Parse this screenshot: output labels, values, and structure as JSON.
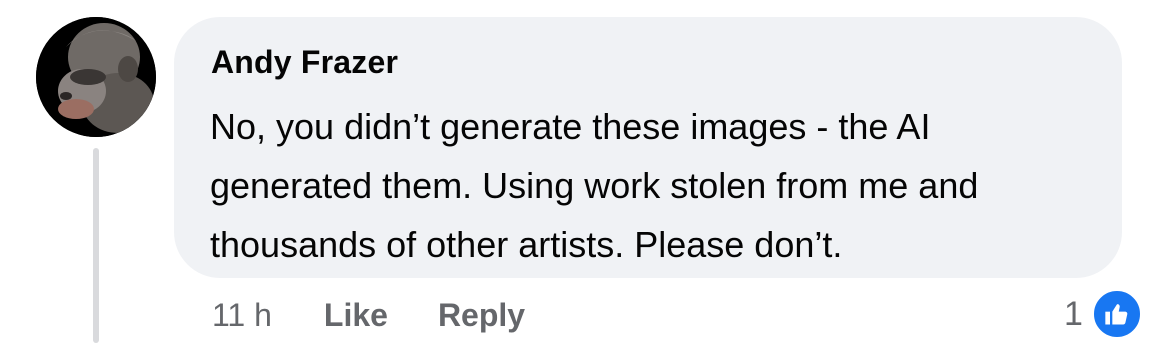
{
  "comment": {
    "author": "Andy Frazer",
    "lines": [
      "No, you didn’t generate these images - the AI",
      "generated them. Using work stolen from me and",
      "thousands of other artists. Please don’t."
    ],
    "timestamp": "11 h",
    "like_label": "Like",
    "reply_label": "Reply",
    "reaction_count": "1",
    "reaction_icon": "thumbs-up-icon"
  },
  "colors": {
    "bubble_bg": "#f0f2f5",
    "text": "#050505",
    "meta_text": "#65676b",
    "like_blue": "#1877f2",
    "thread_line": "#d9dadd"
  }
}
